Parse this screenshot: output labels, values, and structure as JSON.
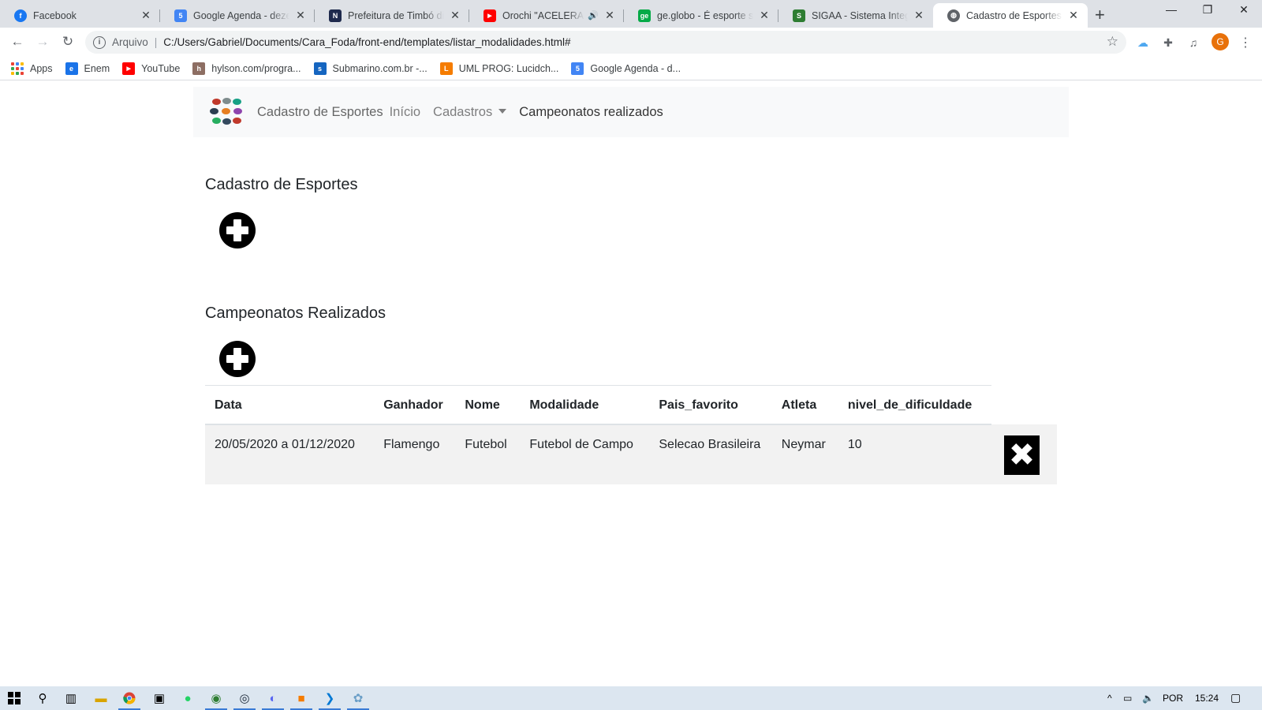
{
  "browser": {
    "tabs": [
      {
        "title": "Facebook",
        "icon": "facebook-icon",
        "color": "#1877f2",
        "glyph": "f"
      },
      {
        "title": "Google Agenda - dezembro",
        "icon": "google-calendar-icon",
        "color": "#4285f4",
        "glyph": "5"
      },
      {
        "title": "Prefeitura de Timbó divulga",
        "icon": "news-icon",
        "color": "#1f2a4d",
        "glyph": "N"
      },
      {
        "title": "Orochi \"ACELERANDO\"",
        "icon": "youtube-icon",
        "color": "#ff0000",
        "glyph": "▶"
      },
      {
        "title": "ge.globo - É esporte sempre",
        "icon": "ge-globo-icon",
        "color": "#06aa48",
        "glyph": "ge"
      },
      {
        "title": "SIGAA - Sistema Integrado",
        "icon": "sigaa-icon",
        "color": "#2e7d32",
        "glyph": "S"
      },
      {
        "title": "Cadastro de Esportes",
        "icon": "globe-icon",
        "color": "#5f6368",
        "glyph": "◍"
      }
    ],
    "address": {
      "scheme": "Arquivo",
      "url": "C:/Users/Gabriel/Documents/Cara_Foda/front-end/templates/listar_modalidades.html#"
    },
    "profile_initial": "G",
    "bookmarks": [
      {
        "label": "Apps",
        "icon": "apps-grid-icon"
      },
      {
        "label": "Enem",
        "icon": "enem-icon",
        "color": "#1a73e8",
        "glyph": "e"
      },
      {
        "label": "YouTube",
        "icon": "youtube-icon",
        "color": "#ff0000",
        "glyph": "▶"
      },
      {
        "label": "hylson.com/progra...",
        "icon": "hylson-icon",
        "color": "#8d6e63",
        "glyph": "h"
      },
      {
        "label": "Submarino.com.br -...",
        "icon": "submarino-icon",
        "color": "#1565c0",
        "glyph": "s"
      },
      {
        "label": "UML PROG: Lucidch...",
        "icon": "lucidchart-icon",
        "color": "#f57c00",
        "glyph": "L"
      },
      {
        "label": "Google Agenda - d...",
        "icon": "google-calendar-icon",
        "color": "#4285f4",
        "glyph": "5"
      }
    ]
  },
  "navbar": {
    "brand": "Cadastro de Esportes",
    "links": [
      "Início",
      "Cadastros",
      "Campeonatos realizados"
    ]
  },
  "sections": {
    "esportes_title": "Cadastro de Esportes",
    "campeonatos_title": "Campeonatos Realizados"
  },
  "table": {
    "headers": [
      "Data",
      "Ganhador",
      "Nome",
      "Modalidade",
      "Pais_favorito",
      "Atleta",
      "nivel_de_dificuldade"
    ],
    "rows": [
      [
        "20/05/2020 a 01/12/2020",
        "Flamengo",
        "Futebol",
        "Futebol de Campo",
        "Selecao Brasileira",
        "Neymar",
        "10"
      ]
    ],
    "delete_glyph": "✖"
  },
  "taskbar": {
    "language": "POR",
    "time": "15:24"
  }
}
